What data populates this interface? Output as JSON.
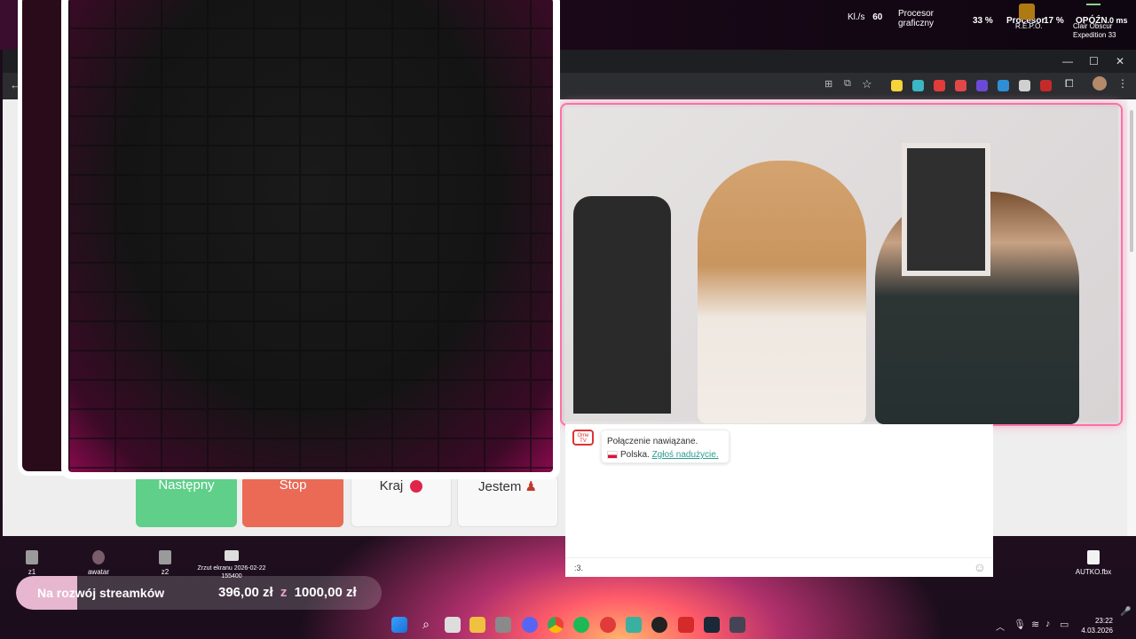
{
  "topbar": {
    "fps_label": "Kl./s",
    "fps_value": "60",
    "gpu_label_1": "Procesor",
    "gpu_label_2": "graficzny",
    "gpu_value": "33 %",
    "cpu_label": "Procesor",
    "cpu_value": "17 %",
    "game_label": "R.E.P.O.",
    "ping_label": "OPÓŹN.",
    "ping_value": "0 ms",
    "game2_line1": "Clair Obscur",
    "game2_line2": "Expedition 33"
  },
  "browser": {
    "minimize": "—",
    "maximize": "☐",
    "close": "✕"
  },
  "buttons": {
    "next": "Następny",
    "stop": "Stop",
    "country": "Kraj",
    "me": "Jestem"
  },
  "chat": {
    "logo": "Ome TV",
    "connected": "Połączenie nawiązane.",
    "country": "Polska.",
    "report_link": "Zgłoś nadużycie.",
    "input_value": ":3.",
    "emoji_icon": "smile-icon"
  },
  "desktop": {
    "icons": [
      {
        "label": "z1"
      },
      {
        "label": "awatar"
      },
      {
        "label": "z2"
      },
      {
        "label": "Zrzut ekranu 2026-02-22 155400"
      },
      {
        "label": "AUTKO.fbx"
      }
    ]
  },
  "goal": {
    "title": "Na rozwój streamków",
    "current": "396,00 zł",
    "separator": "z",
    "target": "1000,00 zł",
    "progress_fraction": 0.396
  },
  "taskbar": {
    "time": "23:22",
    "date": "4.03.2026"
  },
  "colors": {
    "next_button": "#5fcf8a",
    "stop_button": "#ea6a55",
    "video_glow": "#ff6fa6"
  }
}
